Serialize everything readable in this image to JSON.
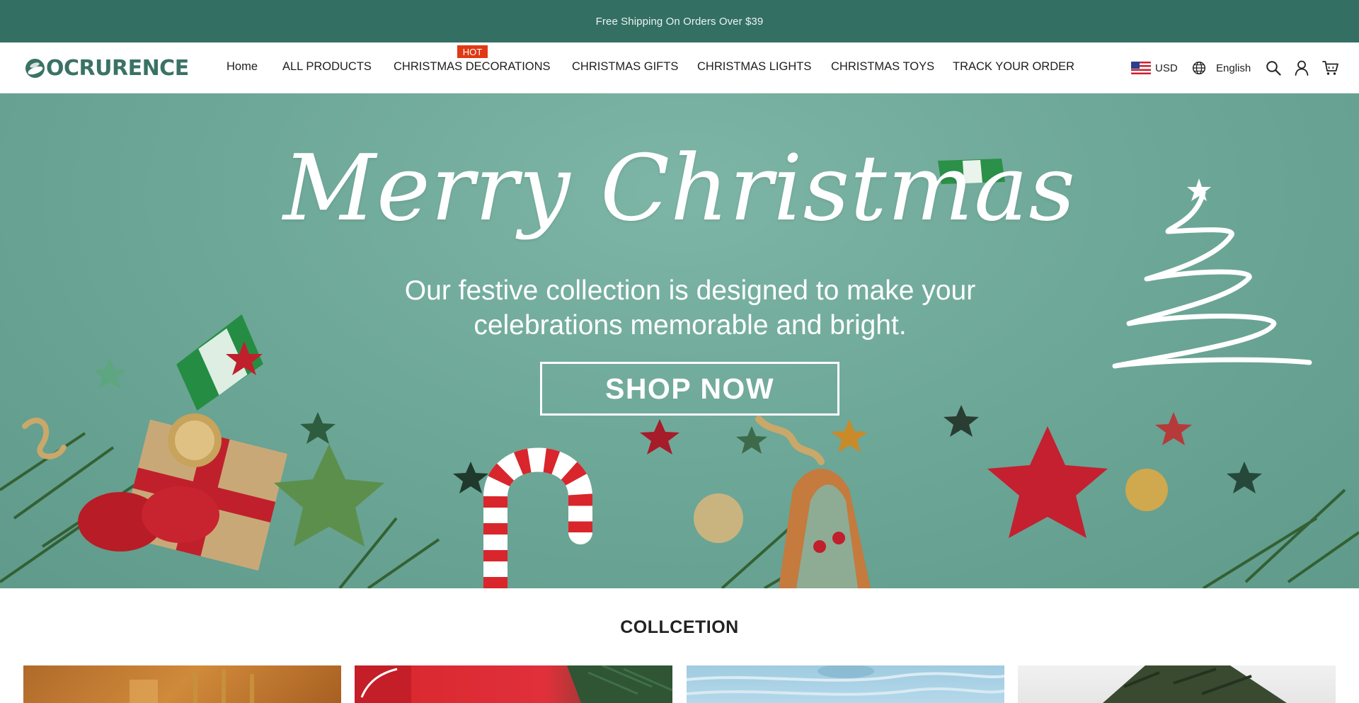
{
  "announcement": {
    "text": "Free Shipping On Orders Over $39"
  },
  "header": {
    "logo_text": "OCRURENCE",
    "nav": [
      {
        "label": "Home"
      },
      {
        "label": "ALL PRODUCTS"
      },
      {
        "label": "CHRISTMAS DECORATIONS",
        "badge": "HOT"
      },
      {
        "label": "CHRISTMAS GIFTS"
      },
      {
        "label": "CHRISTMAS LIGHTS"
      },
      {
        "label": "CHRISTMAS TOYS"
      },
      {
        "label": "TRACK YOUR ORDER"
      }
    ],
    "currency": "USD",
    "language": "English",
    "icons": [
      "us-flag-icon",
      "globe-icon",
      "search-icon",
      "account-icon",
      "cart-icon"
    ]
  },
  "hero": {
    "title": "Merry Christmas",
    "subtitle_line1": "Our festive collection is designed to make your",
    "subtitle_line2": "celebrations memorable and bright.",
    "cta": "SHOP NOW"
  },
  "collection": {
    "title": "COLLCETION"
  },
  "colors": {
    "brand_green": "#336f63",
    "logo_green": "#3a7265",
    "hot_badge": "#e03a14",
    "hero_bg": "#6ea898"
  }
}
